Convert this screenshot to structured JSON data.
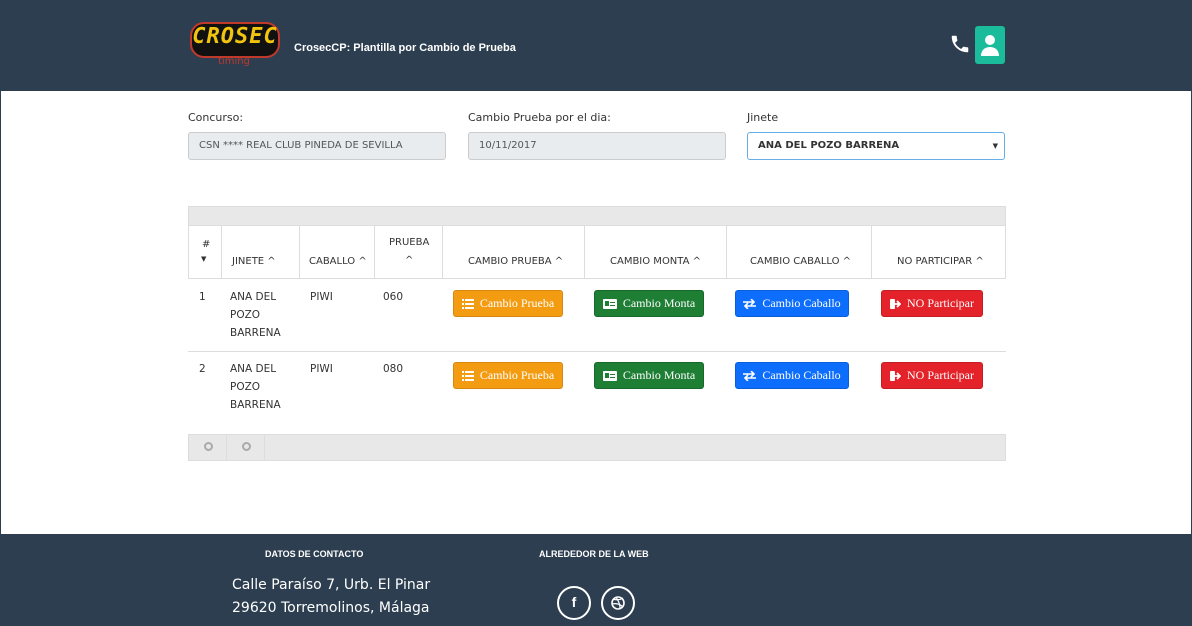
{
  "header": {
    "logo_text": "CROSEC",
    "logo_sub": "timing",
    "title": "CrosecCP: Plantilla por Cambio de Prueba"
  },
  "form": {
    "concurso_label": "Concurso:",
    "concurso_value": "CSN **** REAL CLUB PINEDA DE SEVILLA",
    "fecha_label": "Cambio Prueba por el dia:",
    "fecha_value": "10/11/2017",
    "jinete_label": "Jinete",
    "jinete_value": "ANA DEL POZO BARRENA"
  },
  "table": {
    "columns": {
      "num": "#",
      "jinete": "JINETE ^",
      "caballo": "CABALLO ^",
      "prueba_1": "PRUEBA",
      "prueba_2": "^",
      "cambio_prueba": "CAMBIO PRUEBA ^",
      "cambio_monta": "CAMBIO MONTA ^",
      "cambio_caballo": "CAMBIO CABALLO ^",
      "no_participar": "NO PARTICIPAR ^"
    },
    "rows": [
      {
        "num": "1",
        "jinete_1": "ANA DEL",
        "jinete_2": "POZO",
        "jinete_3": "BARRENA",
        "caballo": "PIWI",
        "prueba": "060"
      },
      {
        "num": "2",
        "jinete_1": "ANA DEL",
        "jinete_2": "POZO",
        "jinete_3": "BARRENA",
        "caballo": "PIWI",
        "prueba": "080"
      }
    ],
    "buttons": {
      "cambio_prueba": "Cambio Prueba",
      "cambio_monta": "Cambio Monta",
      "cambio_caballo": "Cambio Caballo",
      "no_participar": "NO Participar"
    }
  },
  "footer": {
    "contact_title": "DATOS DE CONTACTO",
    "web_title": "ALREDEDOR DE LA WEB",
    "address_1": "Calle Paraíso 7, Urb. El Pinar",
    "address_2": "29620 Torremolinos, Málaga"
  },
  "colors": {
    "header_bg": "#2c3e50",
    "user_button": "#1abc9c",
    "btn_orange": "#f39c12",
    "btn_green": "#1e7e34",
    "btn_blue": "#0d6efd",
    "btn_red": "#e4222a"
  },
  "icons": [
    "phone-icon",
    "user-icon",
    "list-icon",
    "id-card-icon",
    "exchange-icon",
    "sign-out-icon",
    "facebook-icon",
    "dribbble-icon"
  ]
}
